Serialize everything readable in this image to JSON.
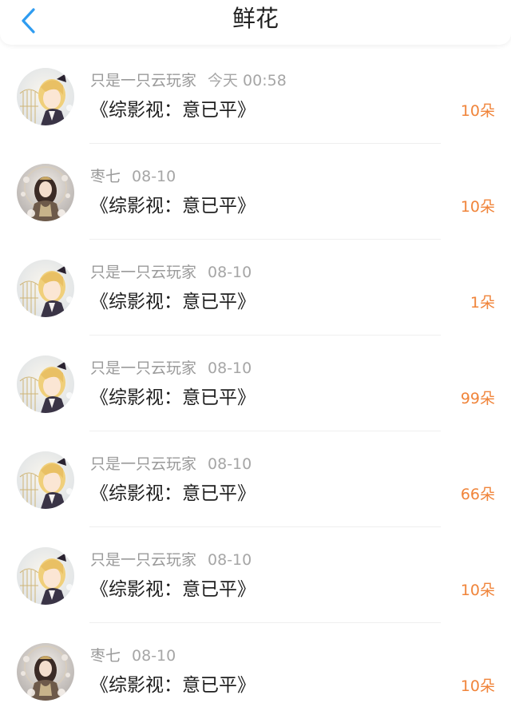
{
  "header": {
    "title": "鲜花",
    "back_icon": "chevron-left-icon",
    "accent_color": "#2f9cf0"
  },
  "colors": {
    "count": "#f0843a",
    "meta": "#9a9a9a",
    "text": "#1f1f1f"
  },
  "rows": [
    {
      "user": "只是一只云玩家",
      "time": "今天 00:58",
      "book": "《综影视：意已平》",
      "count": "10朵",
      "avatar": "avatar-blonde"
    },
    {
      "user": "枣七",
      "time": "08-10",
      "book": "《综影视：意已平》",
      "count": "10朵",
      "avatar": "avatar-dark"
    },
    {
      "user": "只是一只云玩家",
      "time": "08-10",
      "book": "《综影视：意已平》",
      "count": "1朵",
      "avatar": "avatar-blonde"
    },
    {
      "user": "只是一只云玩家",
      "time": "08-10",
      "book": "《综影视：意已平》",
      "count": "99朵",
      "avatar": "avatar-blonde"
    },
    {
      "user": "只是一只云玩家",
      "time": "08-10",
      "book": "《综影视：意已平》",
      "count": "66朵",
      "avatar": "avatar-blonde"
    },
    {
      "user": "只是一只云玩家",
      "time": "08-10",
      "book": "《综影视：意已平》",
      "count": "10朵",
      "avatar": "avatar-blonde"
    },
    {
      "user": "枣七",
      "time": "08-10",
      "book": "《综影视：意已平》",
      "count": "10朵",
      "avatar": "avatar-dark"
    }
  ]
}
